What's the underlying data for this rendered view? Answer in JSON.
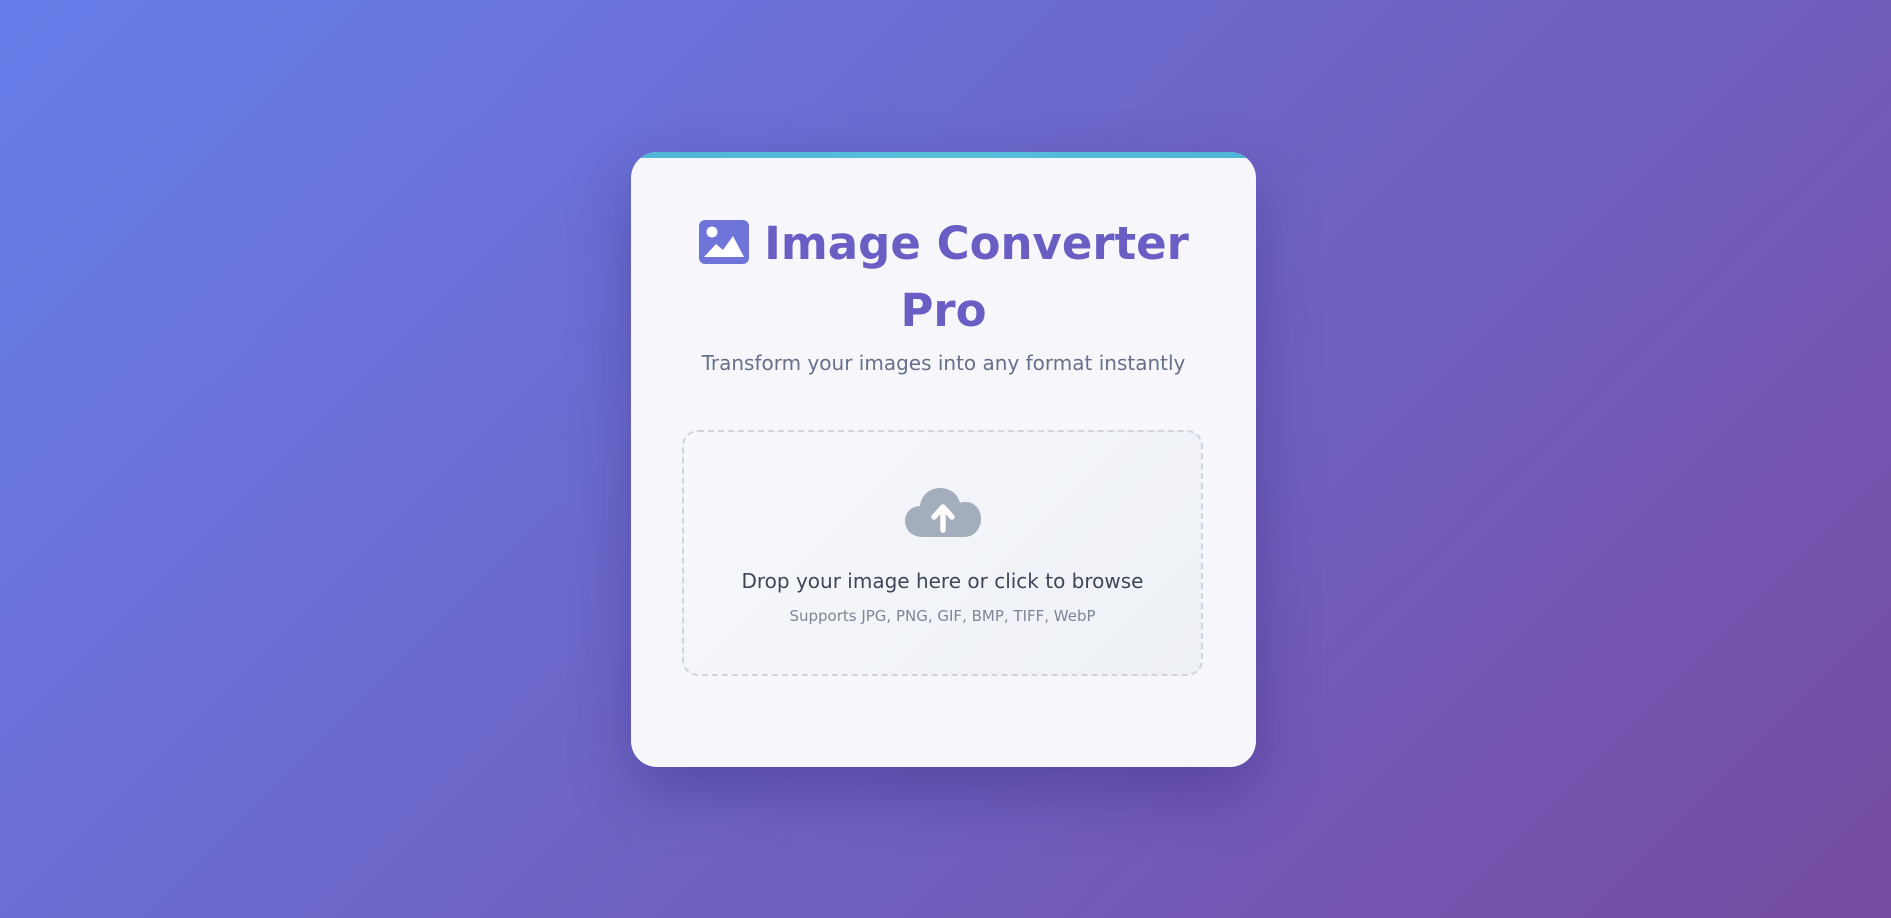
{
  "app": {
    "title_line1": "Image Converter",
    "title_line2": "Pro",
    "title_icon": "image-icon",
    "subtitle": "Transform your images into any format instantly"
  },
  "dropzone": {
    "icon": "cloud-upload-icon",
    "primary_text": "Drop your image here or click to browse",
    "secondary_text": "Supports JPG, PNG, GIF, BMP, TIFF, WebP"
  },
  "colors": {
    "background_start": "#667eea",
    "background_end": "#764ba2",
    "title": "#6a5ec4",
    "accent_bar": "#4fb6d6",
    "card": "#f7f7fb",
    "icon_gray": "#a3adbc"
  }
}
